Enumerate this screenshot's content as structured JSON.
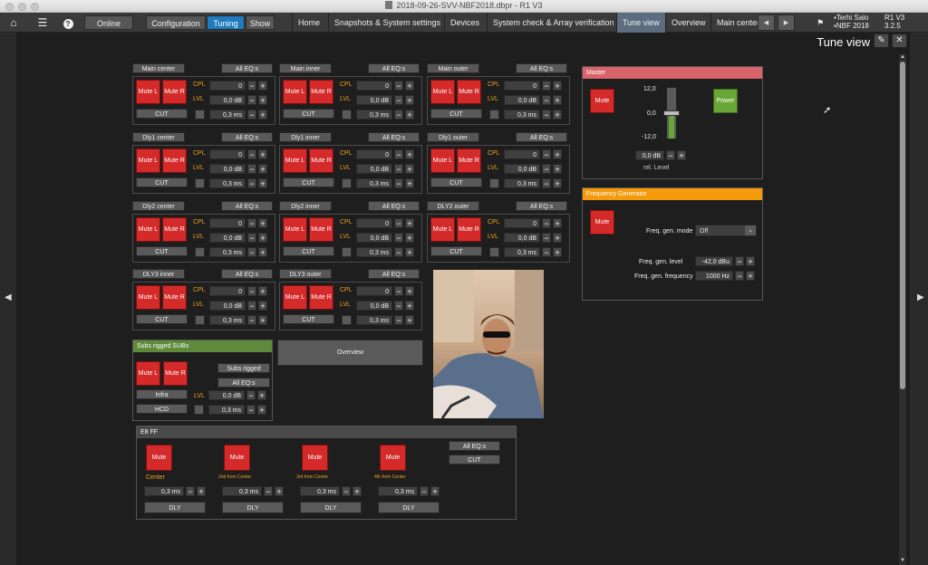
{
  "window": {
    "title": "2018-09-26-SVV-NBF2018.dbpr - R1 V3"
  },
  "topbar": {
    "online_label": "Online",
    "mode_buttons": [
      "Configuration",
      "Tuning",
      "Show"
    ],
    "active_mode": "Tuning",
    "tabs": [
      "Home",
      "Snapshots & System settings",
      "Devices",
      "System check & Array verification",
      "Tune view",
      "Overview",
      "Main center"
    ],
    "active_tab": "Tune view",
    "user_name": "Terhi Salo",
    "project_name": "NBF 2018",
    "app_name": "R1 V3",
    "app_version": "3.2.5"
  },
  "view": {
    "title": "Tune view"
  },
  "common": {
    "mute_l": "Mute L",
    "mute_r": "Mute R",
    "all_eqs": "All EQ:s",
    "cut": "CUT",
    "cpl": "CPL",
    "lvl": "LVL",
    "cpl_value": "0",
    "lvl_value": "0,0 dB",
    "delay_value": "0,3 ms",
    "minus": "−",
    "plus": "+"
  },
  "groups": [
    {
      "name": "Main center"
    },
    {
      "name": "Main inner"
    },
    {
      "name": "Main outer"
    },
    {
      "name": "Dly1 center"
    },
    {
      "name": "Dly1 inner"
    },
    {
      "name": "Dly1 outer"
    },
    {
      "name": "Dly2 center"
    },
    {
      "name": "Dly2 inner"
    },
    {
      "name": "DLY2 outer"
    },
    {
      "name": "DLY3 inner"
    },
    {
      "name": "DLY3 outer"
    }
  ],
  "subs": {
    "title": "Subs rigged SUBs",
    "mute_l": "Mute L",
    "mute_r": "Mute R",
    "subs_rigged": "Subs rigged",
    "all_eqs": "All EQ:s",
    "infra": "Infra",
    "hcd": "HCD",
    "lvl": "LVL",
    "lvl_value": "0,0 dB",
    "delay_value": "0,3 ms"
  },
  "overview_button": "Overview",
  "e8": {
    "title": "E8 FF",
    "mute": "Mute",
    "all_eqs": "All EQ:s",
    "cut": "CUT",
    "dly": "DLY",
    "channels": [
      {
        "label": "Center",
        "delay": "0,3 ms"
      },
      {
        "label": "2nd from Center",
        "delay": "0,3 ms"
      },
      {
        "label": "3rd from Center",
        "delay": "0,3 ms"
      },
      {
        "label": "4th from Center",
        "delay": "0,3 ms"
      }
    ]
  },
  "master": {
    "title": "Master",
    "mute": "Mute",
    "power": "Power",
    "scale_top": "12,0",
    "scale_mid": "0,0",
    "scale_bottom": "-12,0",
    "level_value": "0,0 dB",
    "level_label": "rel. Level",
    "level_fraction": 0.5,
    "header_color": "#d9636a",
    "power_color": "#6aa636"
  },
  "freqgen": {
    "title": "Frequency Generator",
    "mute": "Mute",
    "mode_label": "Freq. gen. mode",
    "mode_value": "Off",
    "level_label": "Freq. gen. level",
    "level_value": "-42,0 dBu",
    "freq_label": "Freq. gen. frequency",
    "freq_value": "1000 Hz",
    "header_color": "#f59a0b"
  },
  "colors": {
    "mute_red": "#d42a2a",
    "accent_orange": "#f0a020",
    "tab_active": "#5d6d80",
    "mode_active": "#1e7bbd",
    "subs_header": "#5e8a3c"
  }
}
